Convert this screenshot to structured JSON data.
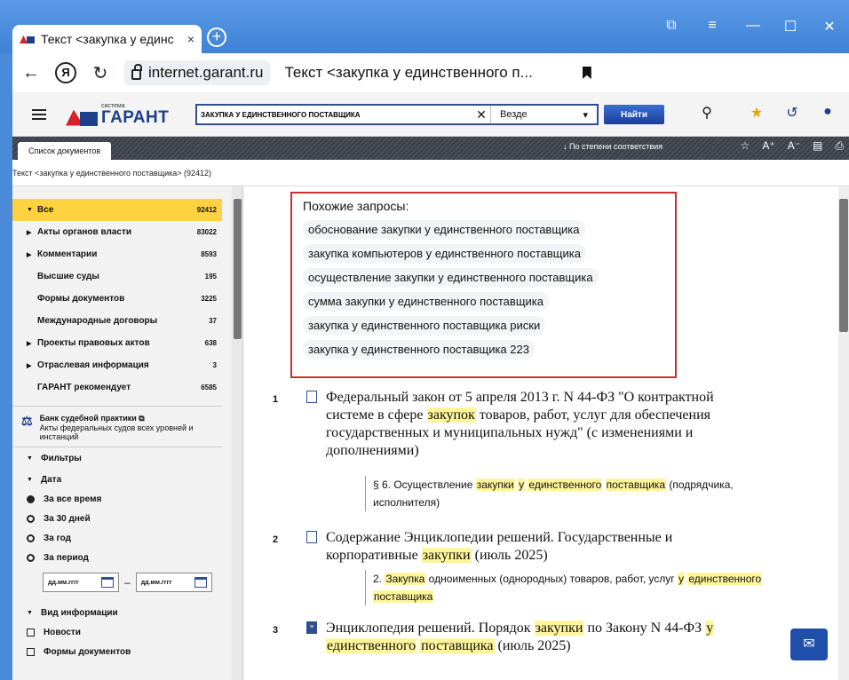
{
  "browser": {
    "tab_title": "Текст <закупка у единс",
    "tab_close": "×",
    "new_tab": "+",
    "back": "←",
    "reload": "↻",
    "yandex": "Я",
    "domain": "internet.garant.ru",
    "page_title": "Текст <закупка у единственного п...",
    "win_minimize": "—",
    "win_maximize": "☐",
    "win_close": "✕"
  },
  "app": {
    "brand_small": "система",
    "brand_name": "ГАРАНТ",
    "search_value": "ЗАКУПКА У ЕДИНСТВЕННОГО ПОСТАВЩИКА",
    "search_clear": "✕",
    "scope": "Везде",
    "find_button": "Найти",
    "doc_tab": "Список документов",
    "sort_label": "↓  По степени соответствия",
    "font_large": "A⁺",
    "font_small": "A⁻",
    "breadcrumb": "Текст <закупка у единственного поставщика> (92412)"
  },
  "sidebar": {
    "categories": [
      {
        "label": "Все",
        "count": "92412",
        "arrow": "▼",
        "active": true
      },
      {
        "label": "Акты органов власти",
        "count": "83022",
        "arrow": "▶"
      },
      {
        "label": "Комментарии",
        "count": "8593",
        "arrow": "▶"
      },
      {
        "label": "Высшие суды",
        "count": "195",
        "arrow": ""
      },
      {
        "label": "Формы документов",
        "count": "3225",
        "arrow": ""
      },
      {
        "label": "Международные договоры",
        "count": "37",
        "arrow": ""
      },
      {
        "label": "Проекты правовых актов",
        "count": "638",
        "arrow": "▶"
      },
      {
        "label": "Отраслевая информация",
        "count": "3",
        "arrow": "▶"
      },
      {
        "label": "ГАРАНТ рекомендует",
        "count": "6585",
        "arrow": ""
      }
    ],
    "bank_title": "Банк судебной практики ⧉",
    "bank_subtitle": "Акты федеральных судов всех уровней и инстанций",
    "filters": "Фильтры",
    "date_section": "Дата",
    "date_options": [
      "За все время",
      "За 30 дней",
      "За год",
      "За период"
    ],
    "date_from": "дд.мм.гггг",
    "date_to": "дд.мм.гггг",
    "date_sep": "–",
    "info_type": "Вид информации",
    "info_items": [
      "Новости",
      "Формы документов"
    ]
  },
  "similar": {
    "title": "Похожие запросы:",
    "queries": [
      "обоснование закупки у единственного поставщика",
      "закупка компьютеров у единственного поставщика",
      "осуществление закупки у единственного поставщика",
      "сумма закупки у единственного поставщика",
      "закупка у единственного поставщика риски",
      "закупка у единственного поставщика 223"
    ]
  },
  "results": [
    {
      "num": "1",
      "title": [
        "Федеральный закон от 5 апреля 2013 г. N 44-ФЗ \"О контрактной системе в сфере ",
        "закупок",
        " товаров, работ, услуг для обеспечения государственных и муниципальных нужд\" (с изменениями и дополнениями)"
      ],
      "sub": [
        "§ 6. Осуществление ",
        "закупки",
        " ",
        "у",
        " ",
        "единственного",
        " ",
        "поставщика",
        " (подрядчика, исполнителя)"
      ]
    },
    {
      "num": "2",
      "title": [
        "Содержание Энциклопедии решений. Государственные и корпоративные ",
        "закупки",
        " (июль 2025)"
      ],
      "sub": [
        "2. ",
        "Закупка",
        " одноименных (однородных) товаров, работ, услуг ",
        "у",
        " ",
        "единственного",
        " ",
        "поставщика",
        ""
      ]
    },
    {
      "num": "3",
      "title": [
        "Энциклопедия решений. Порядок ",
        "закупки",
        " по Закону N 44-ФЗ ",
        "у",
        " ",
        "единственного",
        " ",
        "поставщика",
        " (июль 2025)"
      ],
      "sub": []
    }
  ],
  "colors": {
    "accent": "#ffd23f",
    "brand_blue": "#1e3f8a",
    "brand_red": "#d8202a",
    "highlight": "#fff59a",
    "frame": "#c83232"
  },
  "icons": [
    "notification-icon",
    "filter-list-icon",
    "favorites-star-icon",
    "history-icon",
    "user-icon",
    "bookmark-star-icon",
    "save-icon",
    "print-icon",
    "chat-icon"
  ]
}
